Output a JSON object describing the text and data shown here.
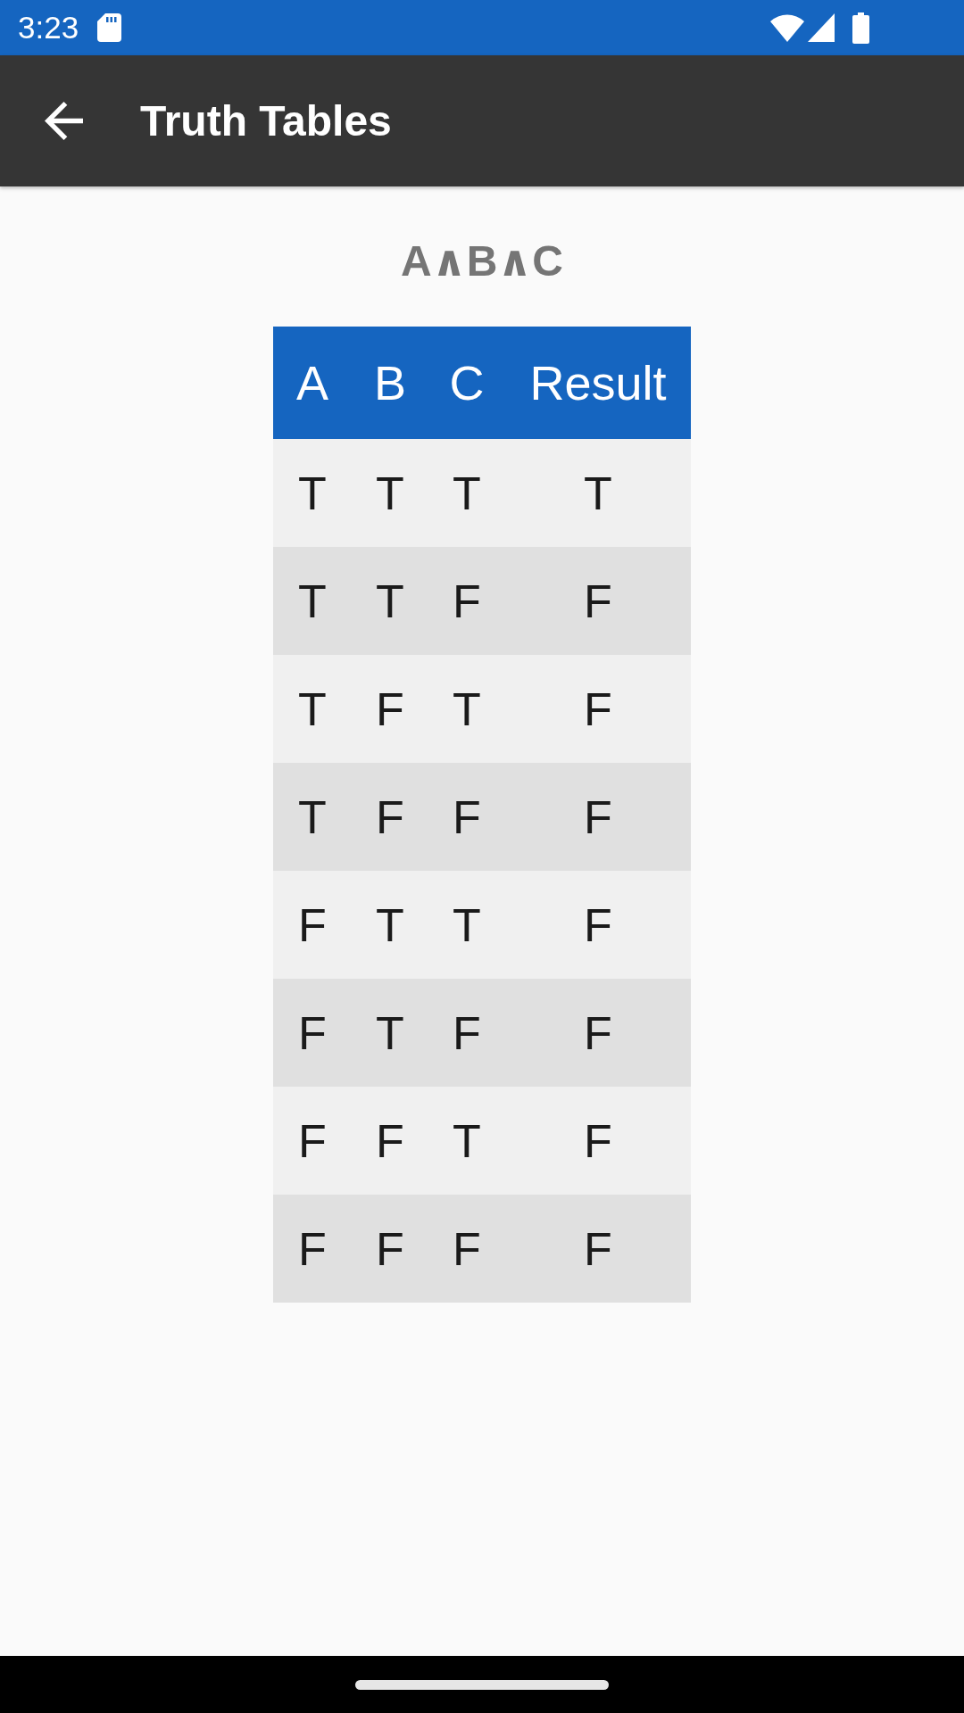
{
  "status_bar": {
    "time": "3:23"
  },
  "app_bar": {
    "title": "Truth Tables"
  },
  "expression": "A∧B∧C",
  "table": {
    "columns": [
      "A",
      "B",
      "C",
      "Result"
    ],
    "rows": [
      [
        "T",
        "T",
        "T",
        "T"
      ],
      [
        "T",
        "T",
        "F",
        "F"
      ],
      [
        "T",
        "F",
        "T",
        "F"
      ],
      [
        "T",
        "F",
        "F",
        "F"
      ],
      [
        "F",
        "T",
        "T",
        "F"
      ],
      [
        "F",
        "T",
        "F",
        "F"
      ],
      [
        "F",
        "F",
        "T",
        "F"
      ],
      [
        "F",
        "F",
        "F",
        "F"
      ]
    ]
  }
}
